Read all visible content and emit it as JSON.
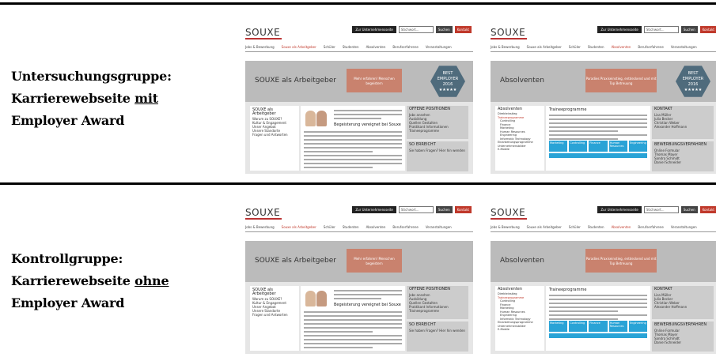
{
  "groups": {
    "experimental": {
      "line1": "Untersuchungsgruppe:",
      "line2_prefix": "Karrierewebseite ",
      "line2_underlined": "mit",
      "line3": "Employer Award"
    },
    "control": {
      "line1": "Kontrollgruppe:",
      "line2_prefix": "Karrierewebseite ",
      "line2_underlined": "ohne",
      "line3": "Employer Award"
    }
  },
  "site": {
    "logo": "SOUXE",
    "header_company": "Zur Unternehmensseite",
    "search_placeholder": "Stichwort...",
    "search_button": "Suchen",
    "contact_button": "Kontakt",
    "nav": [
      "Jobs & Bewerbung",
      "Souxe als Arbeitgeber",
      "Schüler",
      "Studenten",
      "Absolventen",
      "Berufserfahrene",
      "Veranstaltungen"
    ],
    "promo_employer": "Mehr erfahren! Menschen begeistern",
    "promo_graduates": "Paradies Praxiseinstieg, entdeckend und mit Top Betreuung",
    "badge_line1": "BEST",
    "badge_line2": "EMPLOYER",
    "badge_year": "2016",
    "badge_stars": "★★★★★"
  },
  "pages": {
    "employer": {
      "banner_title": "SOUXE als Arbeitgeber",
      "side_title": "SOUXE als Arbeitgeber",
      "side_items": [
        "Warum zu SOUXE?",
        "Kultur & Engagement",
        "Unser Angebot",
        "Unsere Standorte",
        "Fragen und Antworten"
      ],
      "main_heading": "Begeisterung vereignet bei Souxe",
      "right_title": "OFFENE POSITIONEN",
      "right_items": [
        "Jobs ansehen",
        "Ausbildung",
        "Quellen Gestalten",
        "Praktikant Informationen",
        "Traineeprogramme"
      ],
      "right2_title": "SO ERREICHT",
      "right2_text": "Sie haben Fragen? Hier hin wenden"
    },
    "graduates": {
      "banner_title": "Absolventen",
      "side_title": "Absolventen",
      "side_items": [
        "Direkteinstieg",
        "Traineeprogramme",
        "Controlling",
        "Finance",
        "Marketing",
        "Human Resources",
        "Engineering",
        "Informatic Technology",
        "Einarbeitungsprogramme",
        "Unternehmensbilder",
        "E-Mobile"
      ],
      "main_heading": "Traineeprogramme",
      "tiles": [
        "Marketing",
        "Controlling",
        "Finance",
        "Human Resources",
        "Engineering"
      ],
      "right_title": "KONTAKT",
      "right_items": [
        "Lisa Müller",
        "Julia Becker",
        "Christian Weber",
        "Alexander Hoffmann"
      ],
      "right2_title": "BEWERBUNGSVERFAHREN",
      "right2_items": [
        "Online Formular",
        "Thomas Mayer",
        "Sandra Schmidt",
        "Daniel Schneider"
      ]
    }
  }
}
